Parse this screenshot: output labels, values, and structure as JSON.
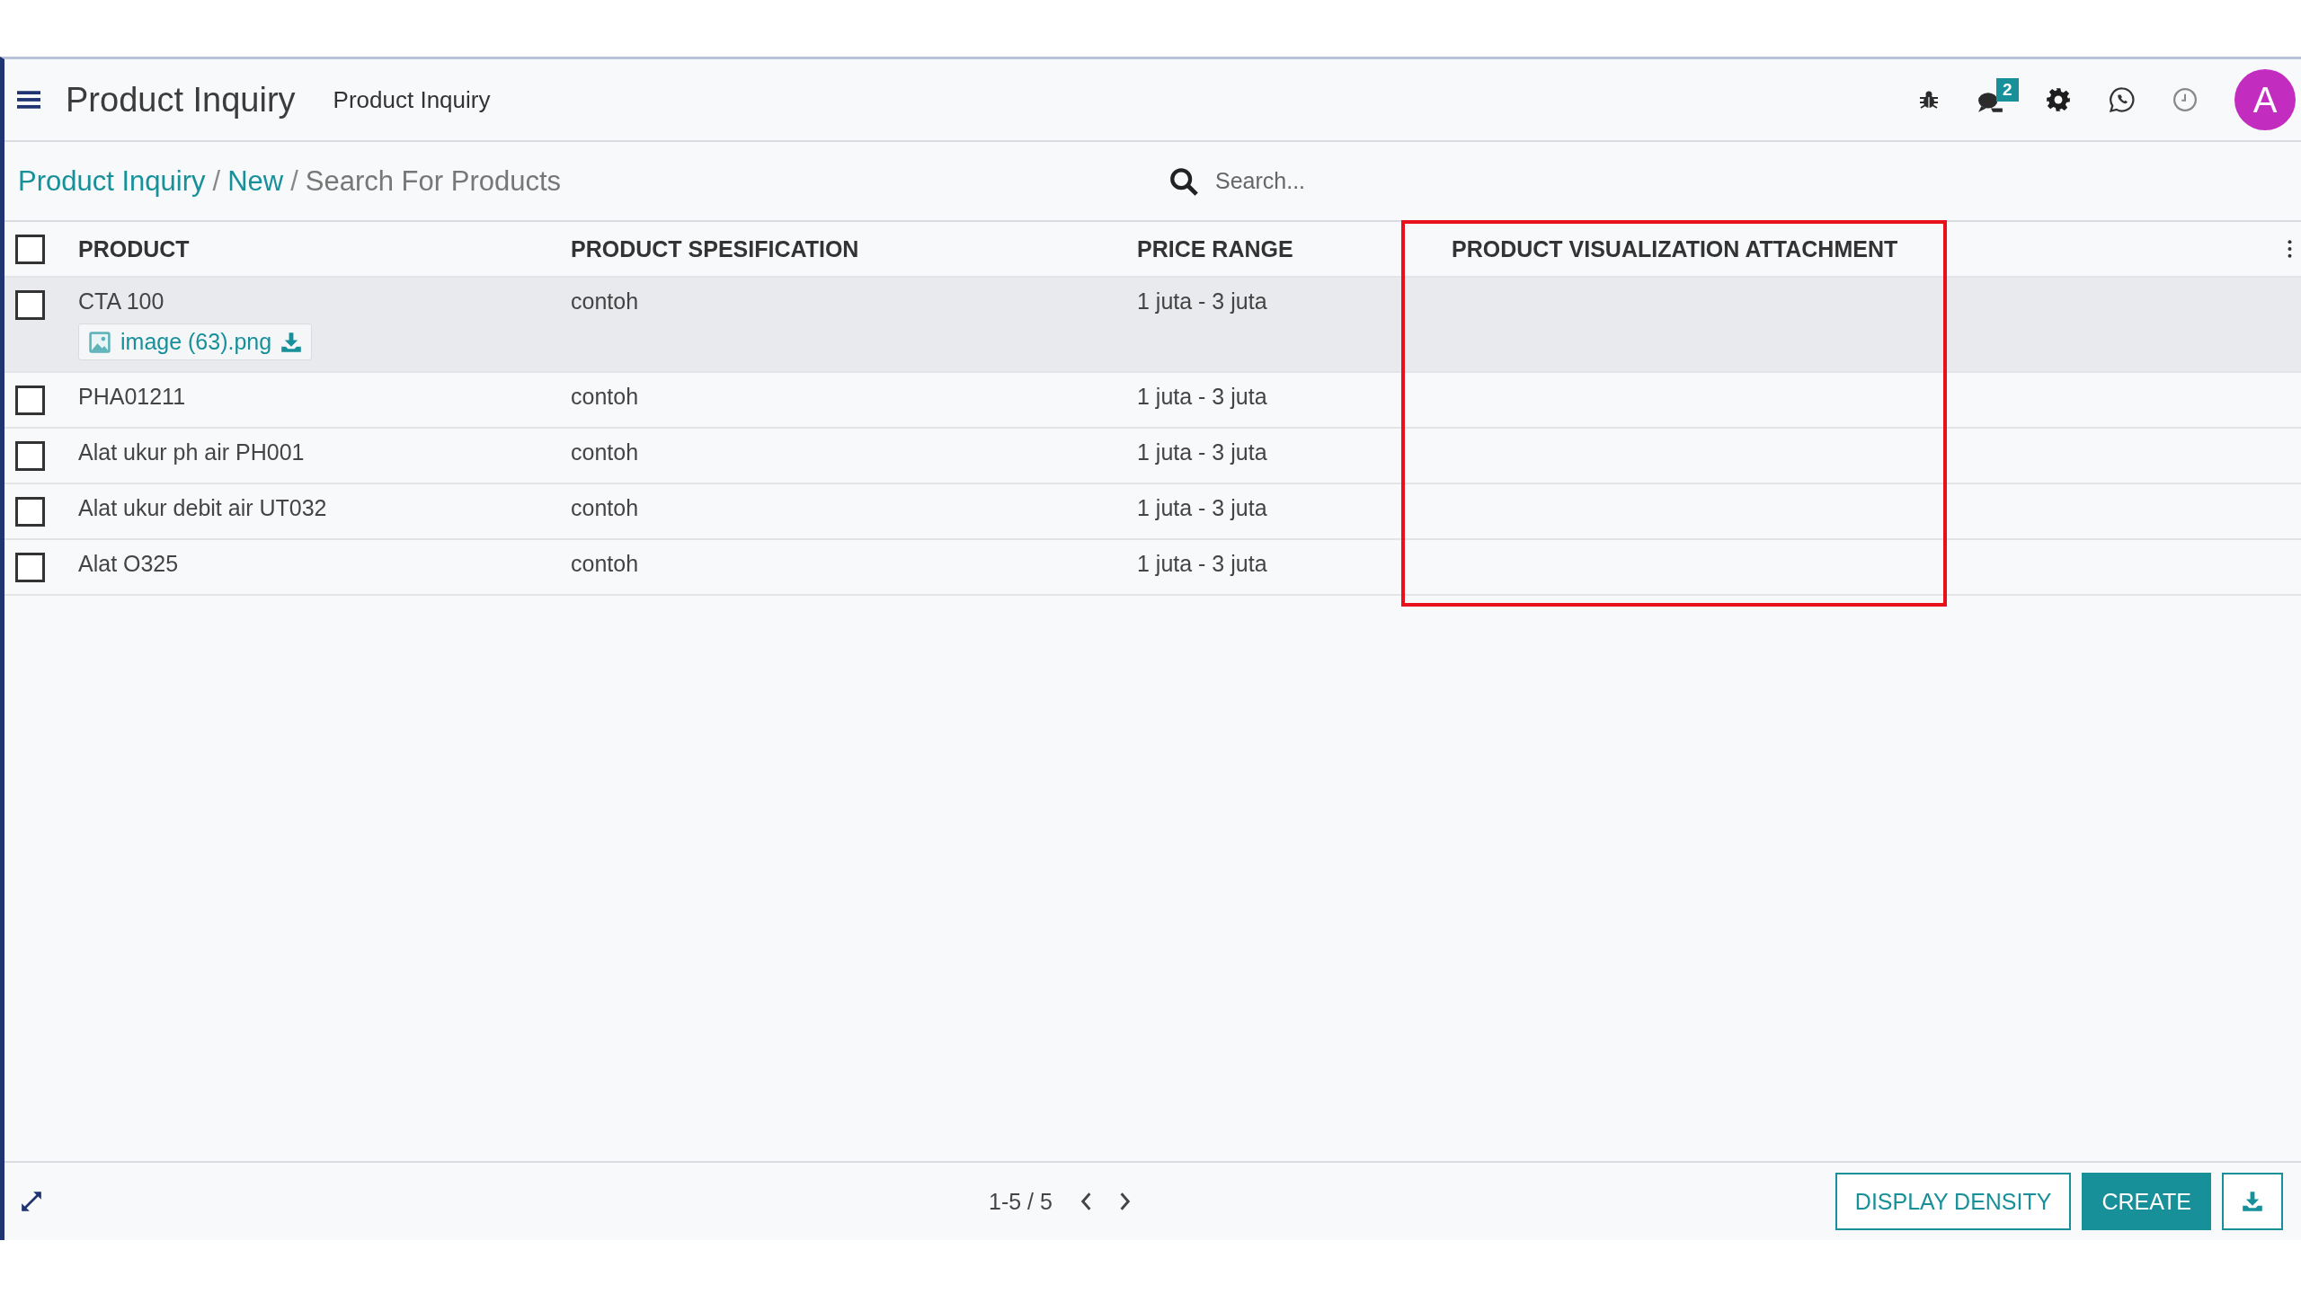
{
  "topbar": {
    "app_title": "Product Inquiry",
    "menu_item": "Product Inquiry",
    "chat_badge": "2",
    "avatar_letter": "A"
  },
  "breadcrumb": {
    "links": [
      "Product Inquiry",
      "New"
    ],
    "separator": "/",
    "current": "Search For Products"
  },
  "search": {
    "placeholder": "Search..."
  },
  "table": {
    "select_all_checked": false,
    "columns": [
      {
        "label": "PRODUCT",
        "highlighted": false
      },
      {
        "label": "PRODUCT SPESIFICATION",
        "highlighted": false
      },
      {
        "label": "PRICE RANGE",
        "highlighted": false
      },
      {
        "label": "PRODUCT VISUALIZATION ATTACHMENT",
        "highlighted": true
      }
    ],
    "rows": [
      {
        "checked": false,
        "selected": true,
        "product": "CTA 100",
        "attachment": "image (63).png",
        "specification": "contoh",
        "price_range": "1 juta - 3 juta"
      },
      {
        "checked": false,
        "selected": false,
        "product": "PHA01211",
        "specification": "contoh",
        "price_range": "1 juta - 3 juta"
      },
      {
        "checked": false,
        "selected": false,
        "product": "Alat ukur ph air PH001",
        "specification": "contoh",
        "price_range": "1 juta - 3 juta"
      },
      {
        "checked": false,
        "selected": false,
        "product": "Alat ukur debit air UT032",
        "specification": "contoh",
        "price_range": "1 juta - 3 juta"
      },
      {
        "checked": false,
        "selected": false,
        "product": "Alat O325",
        "specification": "contoh",
        "price_range": "1 juta - 3 juta"
      }
    ]
  },
  "footer": {
    "pager": "1-5 / 5",
    "buttons": [
      {
        "label": "DISPLAY DENSITY",
        "kind": "outline"
      },
      {
        "label": "CREATE",
        "kind": "primary"
      }
    ]
  }
}
